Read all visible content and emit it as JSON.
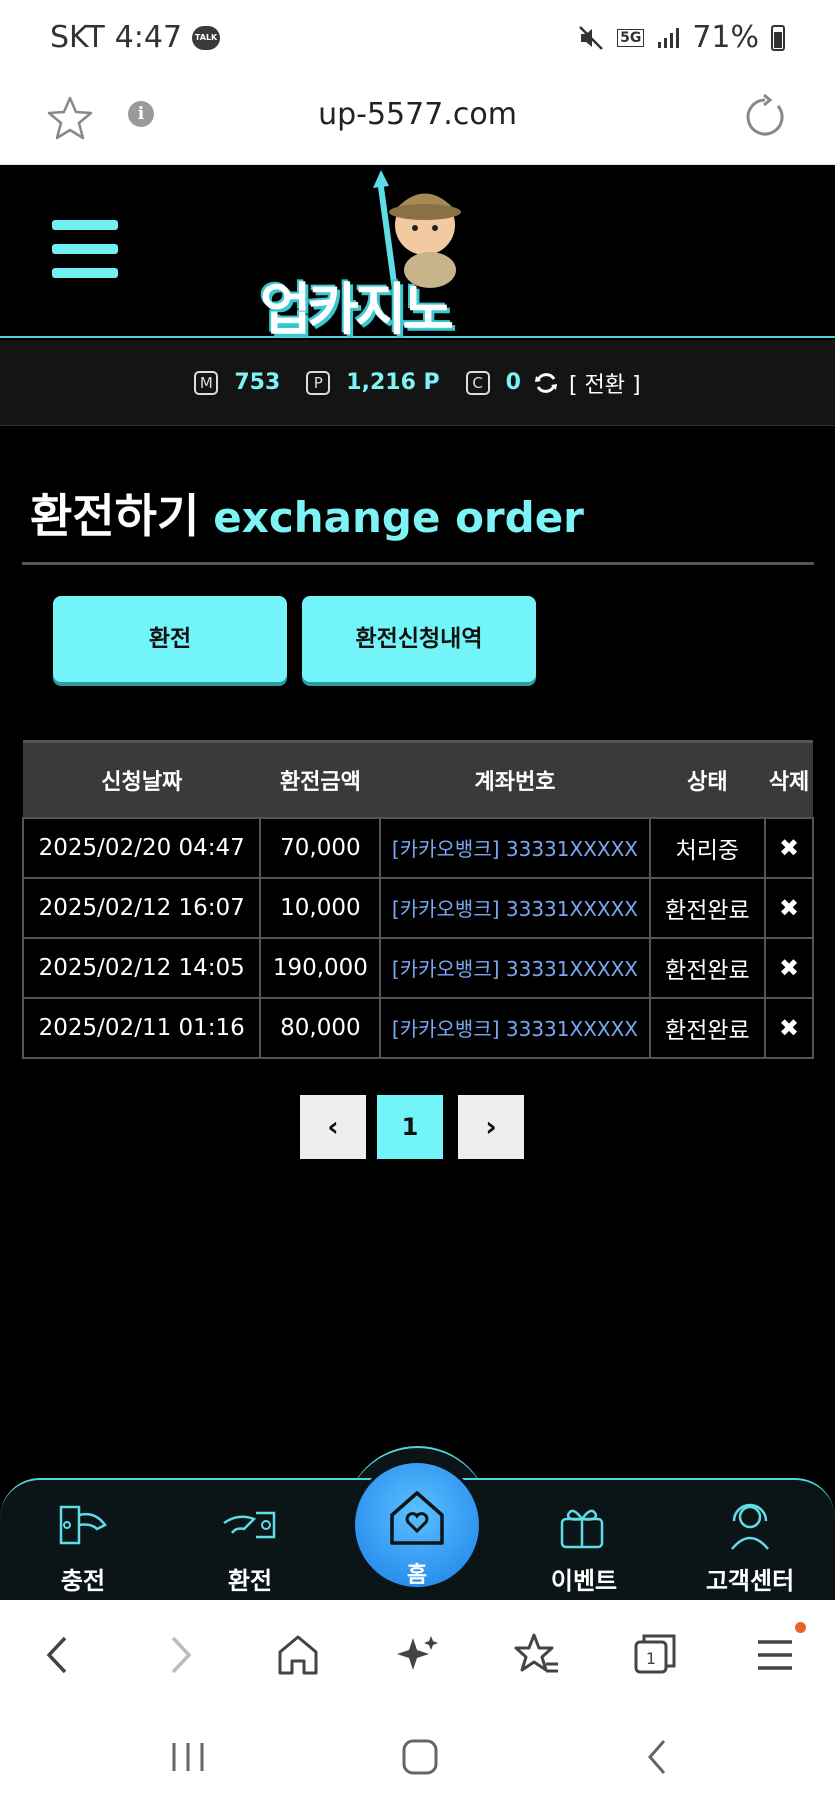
{
  "status_bar": {
    "carrier": "SKT",
    "time": "4:47",
    "talk_badge": "TALK",
    "network": "5G",
    "battery": "71%"
  },
  "browser": {
    "url": "up-5577.com"
  },
  "header": {
    "logo_text": "업카지노"
  },
  "points": {
    "money_icon": "M",
    "money": "753",
    "point_icon": "P",
    "point": "1,216 P",
    "casino_icon": "C",
    "casino": "0",
    "convert_label": "[ 전환 ]"
  },
  "page": {
    "title_ko": "환전하기",
    "title_en": "exchange order"
  },
  "buttons": {
    "exchange": "환전",
    "history": "환전신청내역"
  },
  "table": {
    "headers": [
      "신청날짜",
      "환전금액",
      "계좌번호",
      "상태",
      "삭제"
    ],
    "rows": [
      {
        "date": "2025/02/20 04:47",
        "amount": "70,000",
        "account": "[카카오뱅크] 33331XXXXX",
        "status": "처리중",
        "delete": "✖"
      },
      {
        "date": "2025/02/12 16:07",
        "amount": "10,000",
        "account": "[카카오뱅크] 33331XXXXX",
        "status": "환전완료",
        "delete": "✖"
      },
      {
        "date": "2025/02/12 14:05",
        "amount": "190,000",
        "account": "[카카오뱅크] 33331XXXXX",
        "status": "환전완료",
        "delete": "✖"
      },
      {
        "date": "2025/02/11 01:16",
        "amount": "80,000",
        "account": "[카카오뱅크] 33331XXXXX",
        "status": "환전완료",
        "delete": "✖"
      }
    ]
  },
  "pagination": {
    "prev": "‹",
    "current": "1",
    "next": "›"
  },
  "bottom_nav": {
    "deposit": "충전",
    "exchange": "환전",
    "home": "홈",
    "event": "이벤트",
    "support": "고객센터"
  },
  "colors": {
    "accent": "#72f4f8",
    "background": "#000000",
    "link": "#7aa8f0",
    "home_button": "#1a7ee8"
  }
}
